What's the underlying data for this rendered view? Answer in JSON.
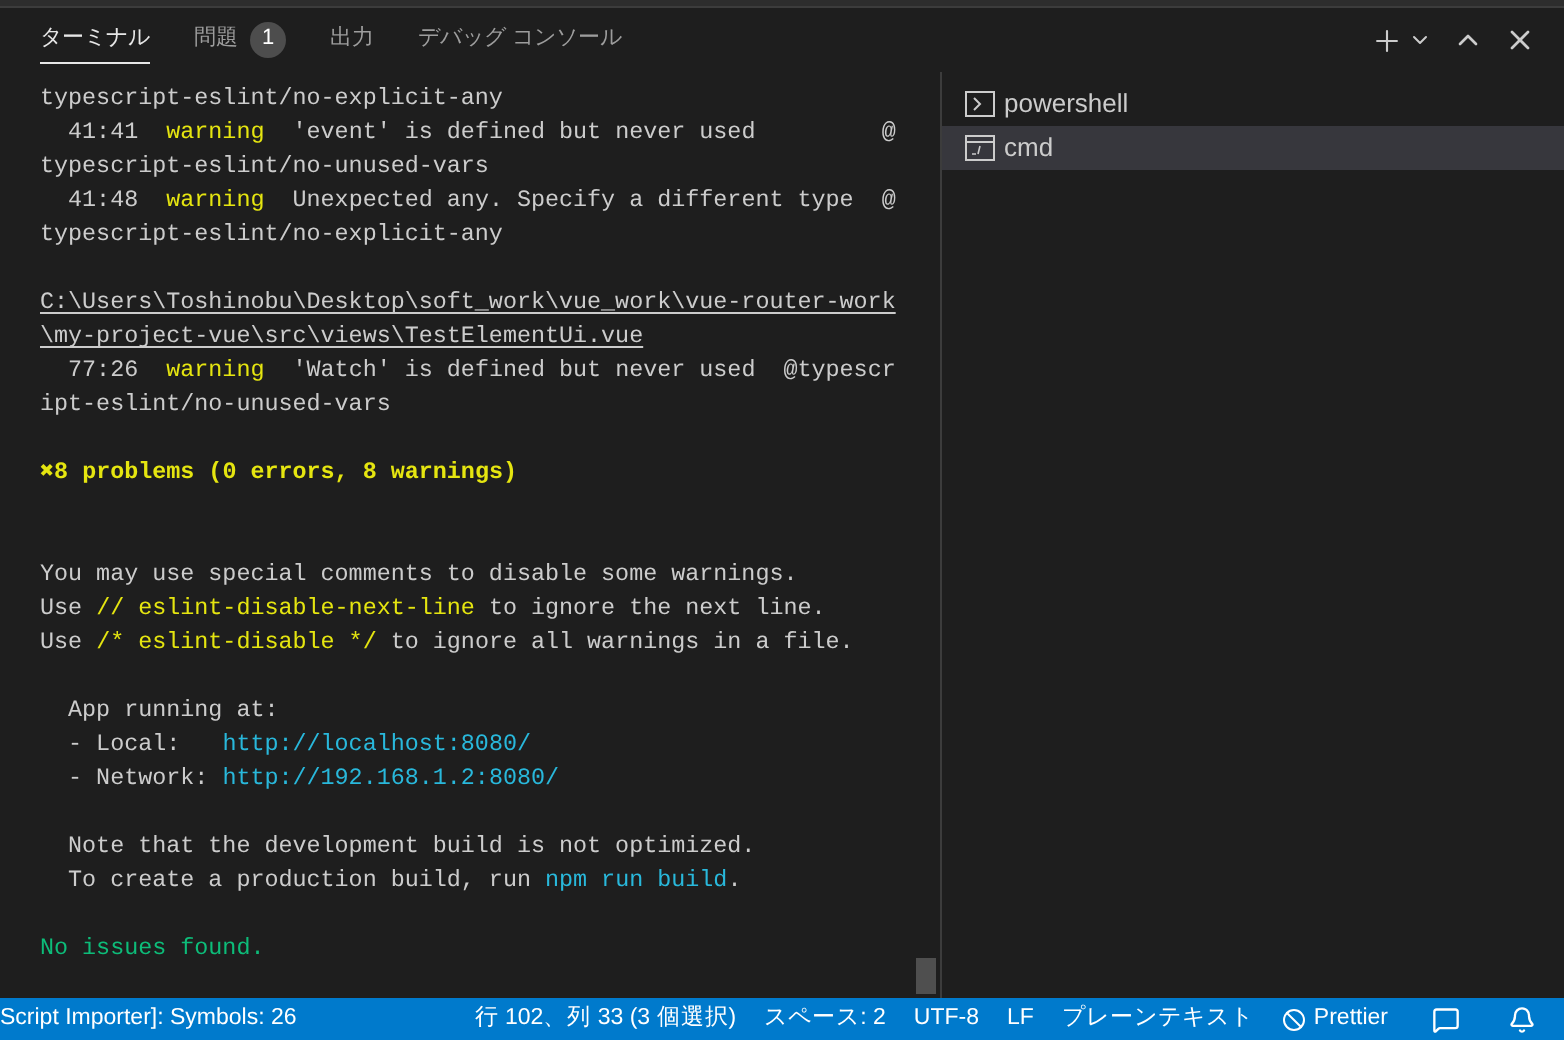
{
  "tabs": [
    {
      "label": "ターミナル",
      "selected": true
    },
    {
      "label": "問題",
      "selected": false,
      "badge": "1"
    },
    {
      "label": "出力",
      "selected": false
    },
    {
      "label": "デバッグ コンソール",
      "selected": false
    }
  ],
  "terminal": {
    "lint_report": [
      [
        {
          "kind": "plain",
          "text": "typescript-eslint/no-explicit-any"
        }
      ],
      [
        {
          "kind": "plain",
          "text": "  41:41  "
        },
        {
          "kind": "warn",
          "text": "warning"
        },
        {
          "kind": "plain",
          "text": "  'event' is defined but never used         @"
        }
      ],
      [
        {
          "kind": "plain",
          "text": "typescript-eslint/no-unused-vars"
        }
      ],
      [
        {
          "kind": "plain",
          "text": "  41:48  "
        },
        {
          "kind": "warn",
          "text": "warning"
        },
        {
          "kind": "plain",
          "text": "  Unexpected any. Specify a different type  @"
        }
      ],
      [
        {
          "kind": "plain",
          "text": "typescript-eslint/no-explicit-any"
        }
      ]
    ],
    "file_report": [
      [
        {
          "kind": "path",
          "text": "C:\\Users\\Toshinobu\\Desktop\\soft_work\\vue_work\\vue-router-work"
        }
      ],
      [
        {
          "kind": "path",
          "text": "\\my-project-vue\\src\\views\\TestElementUi.vue"
        }
      ],
      [
        {
          "kind": "plain",
          "text": "  77:26  "
        },
        {
          "kind": "warn",
          "text": "warning"
        },
        {
          "kind": "plain",
          "text": "  'Watch' is defined but never used  @typescr"
        }
      ],
      [
        {
          "kind": "plain",
          "text": "ipt-eslint/no-unused-vars"
        }
      ]
    ],
    "summary": [
      [
        {
          "kind": "problem",
          "text": "✖8 problems (0 errors, 8 warnings)"
        }
      ]
    ],
    "hints": [
      [
        {
          "kind": "plain",
          "text": "You may use special comments to disable some warnings."
        }
      ],
      [
        {
          "kind": "plain",
          "text": "Use "
        },
        {
          "kind": "warn",
          "text": "// eslint-disable-next-line"
        },
        {
          "kind": "plain",
          "text": " to ignore the next line."
        }
      ],
      [
        {
          "kind": "plain",
          "text": "Use "
        },
        {
          "kind": "warn",
          "text": "/* eslint-disable */"
        },
        {
          "kind": "plain",
          "text": " to ignore all warnings in a file."
        }
      ]
    ],
    "app_info": [
      [
        {
          "kind": "plain",
          "text": "  App running at:"
        }
      ],
      [
        {
          "kind": "plain",
          "text": "  - Local:   "
        },
        {
          "kind": "url",
          "text": "http://localhost:8080/"
        }
      ],
      [
        {
          "kind": "plain",
          "text": "  - Network: "
        },
        {
          "kind": "url",
          "text": "http://192.168.1.2:8080/"
        }
      ]
    ],
    "build_note": [
      [
        {
          "kind": "plain",
          "text": "  Note that the development build is not optimized."
        }
      ],
      [
        {
          "kind": "plain",
          "text": "  To create a production build, run "
        },
        {
          "kind": "url",
          "text": "npm run build"
        },
        {
          "kind": "plain",
          "text": "."
        }
      ]
    ],
    "result": [
      [
        {
          "kind": "ok",
          "text": "No issues found."
        }
      ]
    ]
  },
  "terminals": [
    {
      "kind": "powershell",
      "label": "powershell",
      "selected": false
    },
    {
      "kind": "cmd",
      "label": "cmd",
      "selected": true
    }
  ],
  "status_bar": {
    "left": "Script Importer]: Symbols: 26",
    "items": [
      "行 102、列 33 (3 個選択)",
      "スペース: 2",
      "UTF-8",
      "LF",
      "プレーンテキスト"
    ],
    "formatter": "Prettier"
  }
}
